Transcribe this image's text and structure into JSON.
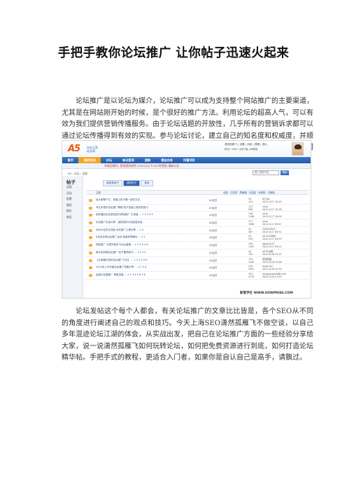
{
  "doc": {
    "title": "手把手教你论坛推广 让你帖子迅速火起来",
    "para1": "论坛推广是以论坛为媒介，论坛推广可以成为支持整个网站推广的主要渠道，尤其是在网站刚开始的时候，是个很好的推广方法。利用论坛的超高人气，可以有效为我们提供营销传播服务。由于论坛话题的开放性，几乎所有的营销诉求都可以通过论坛传播得到有效的实现。参与论坛讨论，建立自己的知名度和权威度，并顺带着推广一下自己的产品或服务。运用的好的话，论坛推广可以是非常有效果的网络营销手段。",
    "para2": "论坛发帖这个每个人都会，有关论坛推广的文章比比皆是，各个SEO从不同的角度进行阐述自己的观点和技巧。今天上海SEO潇然孤雁飞不做空谈，以自己多年混迹论坛江湖的体会，从实战出发，把自己在论坛推广方面的一些经验分享给大家，说一说潇然孤雁飞如何玩转论坛，如何把免费资源进行到底，如何打造论坛精华帖。手把手式的教程，更适合入门者，如果你是自认自己是高手，请飘过。"
  },
  "screenshot": {
    "logo_text": "A5",
    "logo_sub": "站长之家\n站长网",
    "top_links": "潇然孤雁飞 | 设置 | 消息 | 提醒 | 退出",
    "top_links2": "积分: 3187 | 用户组: A5精英",
    "nav": [
      "首页",
      "我的空间",
      "论坛",
      "每日签到",
      "团购",
      "提金任务",
      "托管项目"
    ],
    "notice": "幸福回报网 | 提现规则说明 (1000元以下24小时到账) 最新公告",
    "crumb": "A5 › 论坛 › 全部",
    "search_placeholder": "输入搜索内容",
    "search_button": "搜索",
    "sidebar_heading": "帖子",
    "sidebar_items": [
      "全部",
      "活动",
      "投票",
      "悬赏",
      "辩论",
      "商品"
    ],
    "tabs": [
      "我发表帖子",
      "我的帖子",
      "发帖"
    ],
    "table_head": {
      "title": "主题",
      "author": "来源/作者",
      "reply": "回复/查看",
      "last": "最后发表"
    },
    "filters": "全部 · 已发表 · 草稿箱 · 已回复 · 待审核 · 已删除",
    "rows": [
      {
        "title": "找大家帮个忙，快速上帖子第一页的方法",
        "author": "A5会员",
        "reply": "29\n132",
        "last": "627qq\n2012-8-17 10:29"
      },
      {
        "title": "专业手把手论坛推广教程 帖子迅速上首页的技巧",
        "author": "A5会员",
        "reply": "121\n938",
        "last": "niluo\n2012-8-17 10:18"
      },
      {
        "title": "如何通过论坛发帖进行网站推广 引流量 ...  1 2 3 4 5",
        "author": "A5会员",
        "reply": "126\n1196",
        "last": "niluo\n2012-8-17 10:04"
      },
      {
        "title": "论坛推广实战分享：高效发帖引流经验总结",
        "author": "A5会员",
        "reply": "177\n1969",
        "last": "niluo\n2012-8-17 09:47"
      },
      {
        "title": "6月A5会员交流贴 站长推广心得分享 ...  1 2",
        "author": "A5会员",
        "reply": "32\n367",
        "last": "259339075\n2012-8-17 09:31"
      },
      {
        "title": "6月站长网论坛推广活动 免费获得曝光 ...  1 2",
        "author": "A5会员",
        "reply": "31\n255",
        "last": "201249668\n2012-8-17 09:25"
      },
      {
        "title": "网站推广 从零开始学习论坛营销 ...  1 2 3 4 5 6",
        "author": "A5会员",
        "reply": "194\n1187",
        "last": "qqxiao123\n2012-8-17 09:12"
      },
      {
        "title": "新手如何做论坛推广 帖子置顶技巧 ...  1 2 3 4",
        "author": "A5会员",
        "reply": "54\n745",
        "last": "ASYO谷歌\n2012-8-16 23:15"
      },
      {
        "title": "【大家都在用的论坛推广方法】 ...  1 2 3 4 5 6",
        "author": "A5会员",
        "reply": "179\n1563",
        "last": "梦想家园\n2012-8-16 22:46"
      },
      {
        "title": "2012年上半年度论坛推广效果分享 ...  1 2 3 4",
        "author": "A5会员",
        "reply": "234\n2851",
        "last": "myforrev\n2012-8-16 22:30"
      },
      {
        "title": "运用论坛做推广 获取流量 ...  1 2 3 4 5 6 7 8",
        "author": "A5会员",
        "reply": "323\n4715",
        "last": "wangangwoo66.com\n2012-8-16 21:55"
      }
    ],
    "watermark": "斯普学社 WWW.SOWPRISS.COM"
  },
  "colors": {
    "nav_blue": "#2d65b0",
    "accent_orange": "#e95a0c",
    "link_blue": "#2b4a80"
  }
}
